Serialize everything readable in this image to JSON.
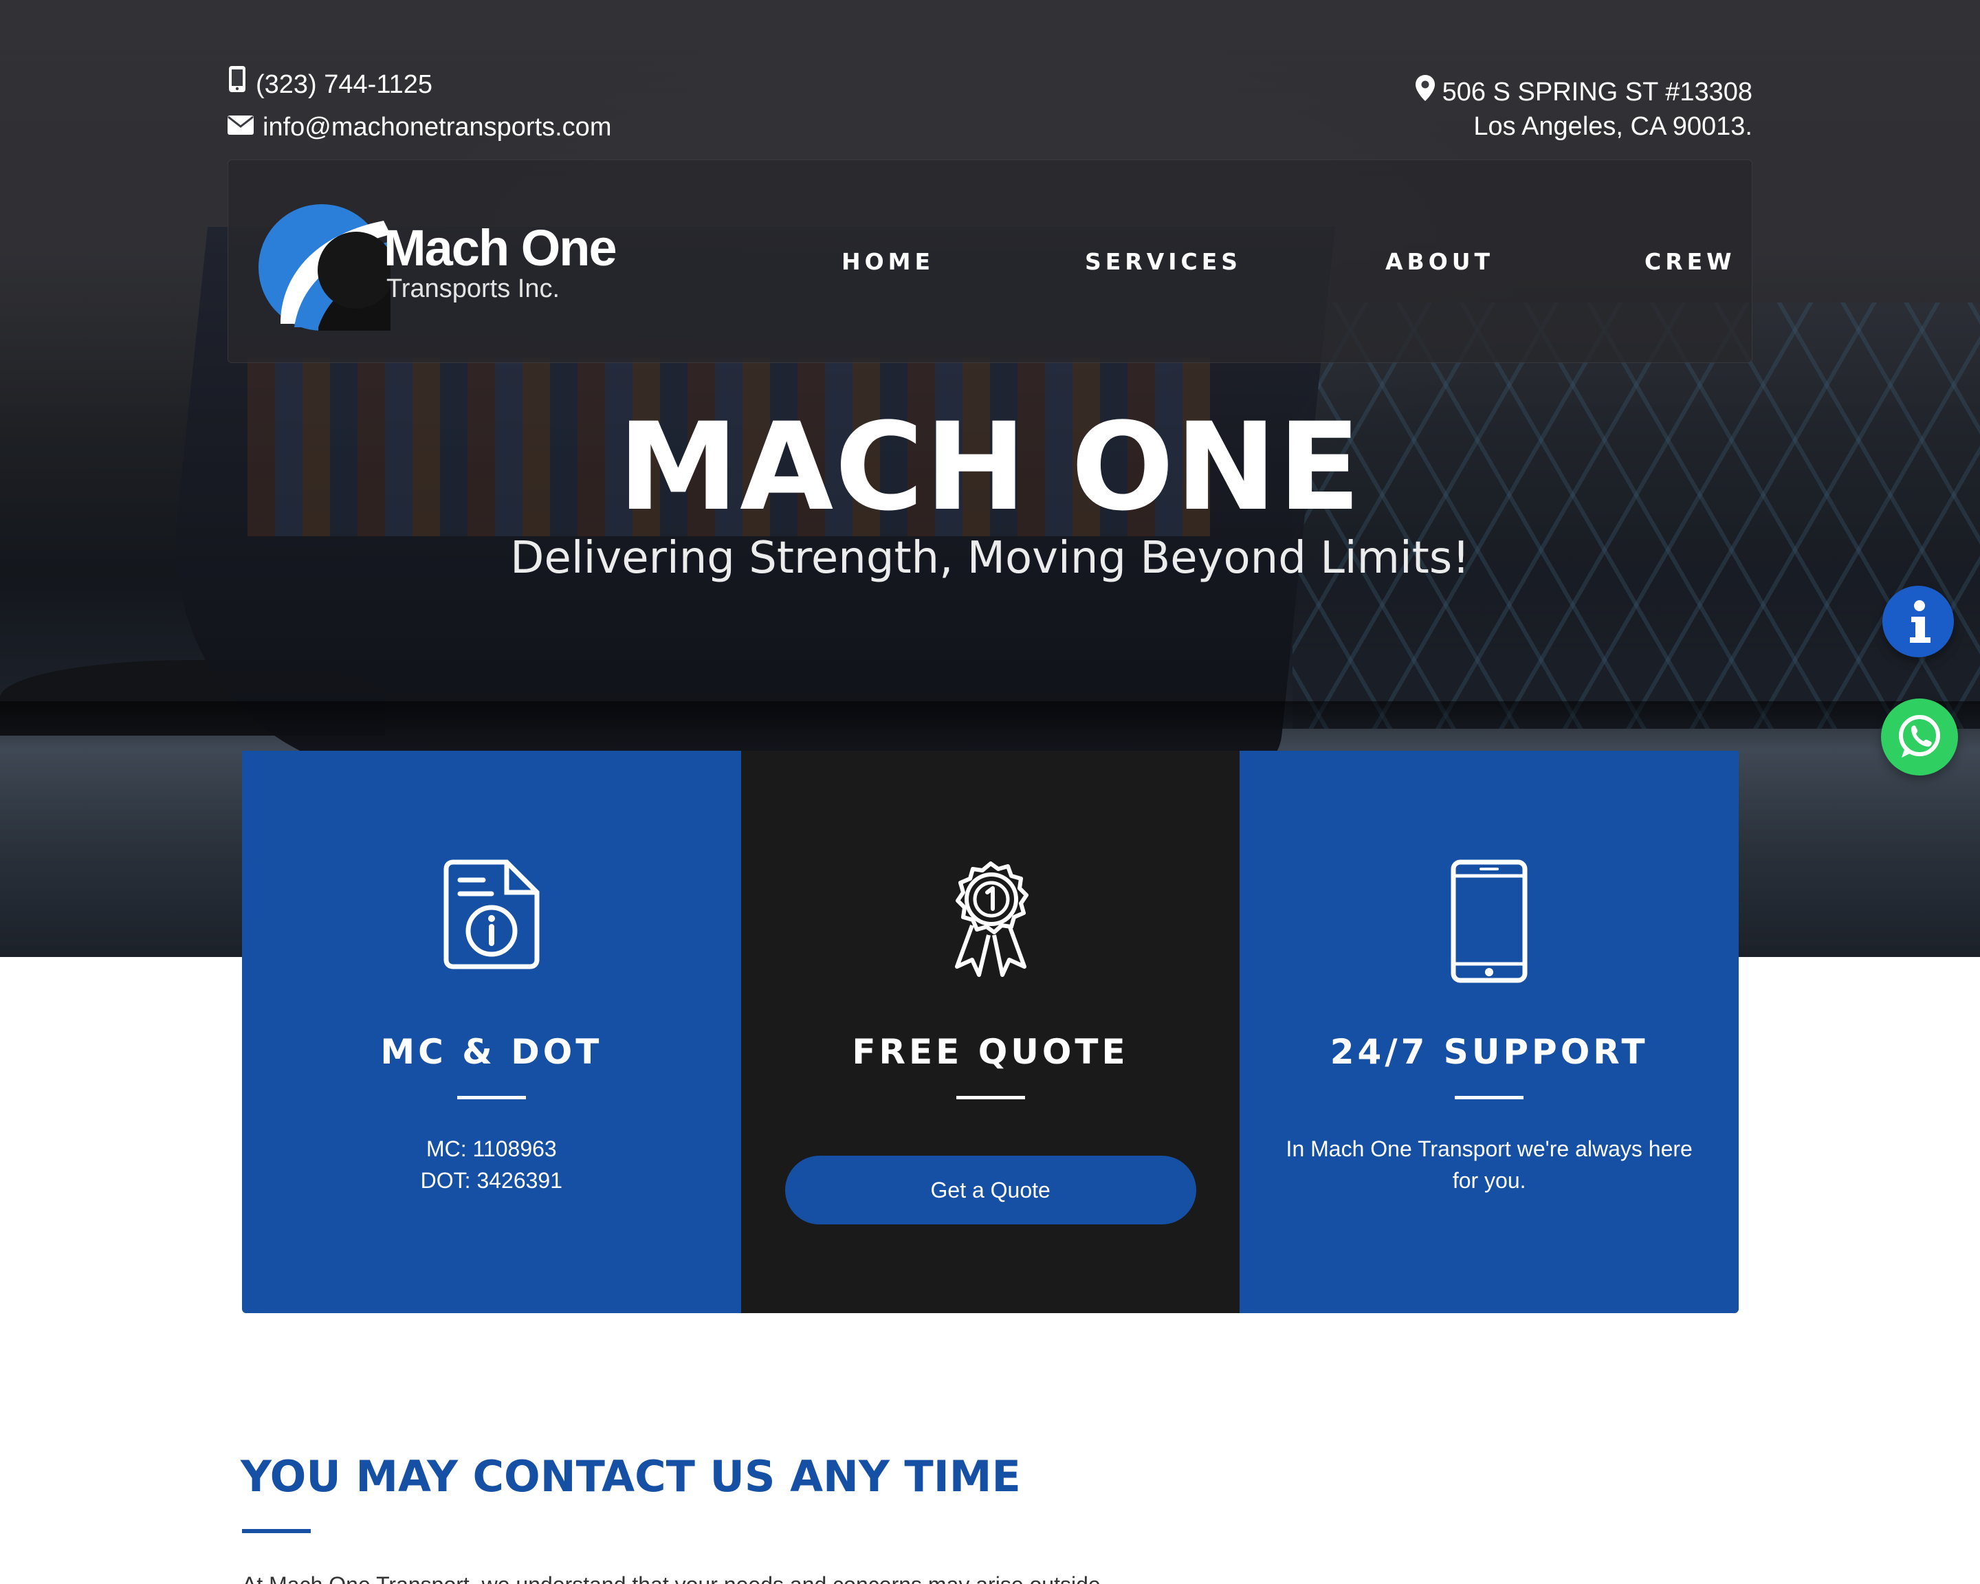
{
  "contact": {
    "phone": "(323) 744-1125",
    "email": "info@machonetransports.com",
    "address_line1": "506 S SPRING ST #13308",
    "address_line2": "Los Angeles, CA 90013."
  },
  "logo": {
    "name": "Mach One",
    "sub": "Transports Inc."
  },
  "nav": {
    "items": [
      {
        "label": "HOME"
      },
      {
        "label": "SERVICES"
      },
      {
        "label": "ABOUT"
      },
      {
        "label": "CREW"
      }
    ]
  },
  "hero": {
    "title": "MACH ONE",
    "subtitle": "Delivering Strength, Moving Beyond Limits!"
  },
  "cards": [
    {
      "title": "MC & DOT",
      "line1": "MC: 1108963",
      "line2": "DOT: 3426391",
      "icon": "document-info-icon"
    },
    {
      "title": "FREE QUOTE",
      "button": "Get a Quote",
      "icon": "award-ribbon-icon"
    },
    {
      "title": "24/7 SUPPORT",
      "text": "In Mach One Transport we're always here for you.",
      "icon": "smartphone-icon"
    }
  ],
  "contact_section": {
    "heading": "YOU MAY CONTACT US ANY TIME",
    "body": "At Mach One Transport, we understand that your needs and concerns may arise outside"
  },
  "colors": {
    "brand_blue": "#1650a4",
    "dark": "#1a1a1a",
    "whatsapp": "#2fcf62",
    "info": "#1b5dc8"
  }
}
